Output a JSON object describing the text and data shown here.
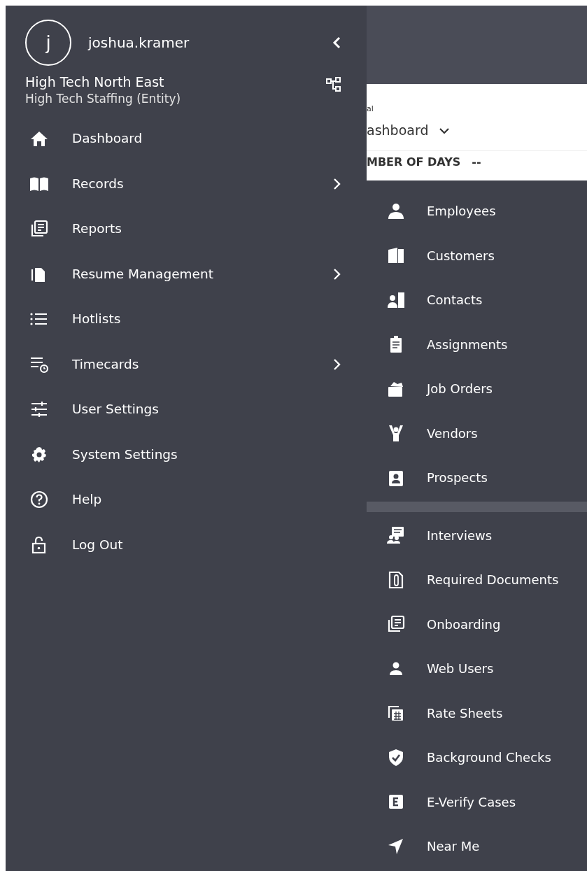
{
  "user": {
    "initial": "j",
    "username": "joshua.kramer"
  },
  "organization": {
    "name": "High Tech North East",
    "entity": "High Tech Staffing (Entity)"
  },
  "menu": [
    {
      "label": "Dashboard",
      "has_submenu": false
    },
    {
      "label": "Records",
      "has_submenu": true
    },
    {
      "label": "Reports",
      "has_submenu": false
    },
    {
      "label": "Resume Management",
      "has_submenu": true
    },
    {
      "label": "Hotlists",
      "has_submenu": false
    },
    {
      "label": "Timecards",
      "has_submenu": true
    },
    {
      "label": "User Settings",
      "has_submenu": false
    },
    {
      "label": "System Settings",
      "has_submenu": false
    },
    {
      "label": "Help",
      "has_submenu": false
    },
    {
      "label": "Log Out",
      "has_submenu": false
    }
  ],
  "background_page": {
    "label": "al",
    "dashboard_select": "ashboard",
    "stat_label": "MBER OF DAYS",
    "stat_value": "--"
  },
  "submenu_groups": [
    {
      "items": [
        {
          "label": "Employees"
        },
        {
          "label": "Customers"
        },
        {
          "label": "Contacts"
        },
        {
          "label": "Assignments"
        },
        {
          "label": "Job Orders"
        },
        {
          "label": "Vendors"
        },
        {
          "label": "Prospects"
        }
      ]
    },
    {
      "items": [
        {
          "label": "Interviews"
        },
        {
          "label": "Required Documents"
        },
        {
          "label": "Onboarding"
        },
        {
          "label": "Web Users"
        },
        {
          "label": "Rate Sheets"
        },
        {
          "label": "Background Checks"
        },
        {
          "label": "E-Verify Cases"
        },
        {
          "label": "Near Me"
        }
      ]
    }
  ]
}
